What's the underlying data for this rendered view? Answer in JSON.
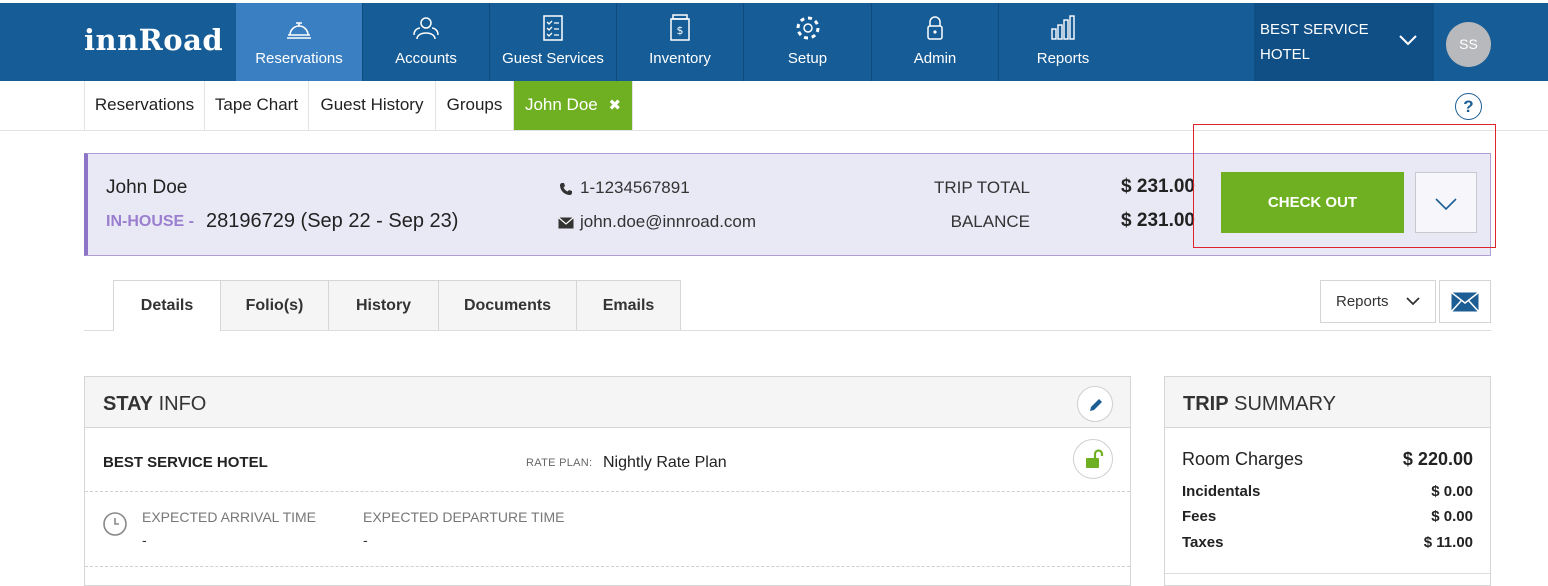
{
  "brand": {
    "logo": "innRoad"
  },
  "topnav": {
    "items": [
      {
        "label": "Reservations",
        "icon": "bell-icon",
        "active": true
      },
      {
        "label": "Accounts",
        "icon": "users-icon"
      },
      {
        "label": "Guest Services",
        "icon": "checklist-icon"
      },
      {
        "label": "Inventory",
        "icon": "inventory-icon"
      },
      {
        "label": "Setup",
        "icon": "gear-icon"
      },
      {
        "label": "Admin",
        "icon": "lock-icon"
      },
      {
        "label": "Reports",
        "icon": "bar-chart-icon"
      }
    ],
    "hotel_line1": "BEST SERVICE",
    "hotel_line2": "HOTEL",
    "avatar": "SS"
  },
  "subnav": {
    "tabs": [
      "Reservations",
      "Tape Chart",
      "Guest History",
      "Groups"
    ],
    "open_tab": "John Doe",
    "help": "?"
  },
  "reservation": {
    "guest_name": "John Doe",
    "status": "IN-HOUSE -",
    "number": "28196729 (Sep 22 - Sep 23)",
    "phone": "1-1234567891",
    "email": "john.doe@innroad.com",
    "trip_total_label": "TRIP TOTAL",
    "trip_total": "$ 231.00",
    "balance_label": "BALANCE",
    "balance": "$ 231.00",
    "checkout_label": "CHECK OUT"
  },
  "detail_tabs": [
    "Details",
    "Folio(s)",
    "History",
    "Documents",
    "Emails"
  ],
  "reports_label": "Reports",
  "stay_info": {
    "title_bold": "STAY",
    "title_rest": " INFO",
    "hotel": "BEST SERVICE HOTEL",
    "rate_plan_label": "RATE PLAN:",
    "rate_plan": "Nightly Rate Plan",
    "arrival_label": "EXPECTED ARRIVAL TIME",
    "arrival_value": "-",
    "departure_label": "EXPECTED DEPARTURE TIME",
    "departure_value": "-"
  },
  "trip_summary": {
    "title_bold": "TRIP",
    "title_rest": " SUMMARY",
    "rows": [
      {
        "label": "Room Charges",
        "value": "$ 220.00"
      },
      {
        "label": "Incidentals",
        "value": "$ 0.00"
      },
      {
        "label": "Fees",
        "value": "$ 0.00"
      },
      {
        "label": "Taxes",
        "value": "$ 11.00"
      }
    ]
  },
  "colors": {
    "nav": "#165c96",
    "nav_active": "#3a7fc1",
    "green": "#6fb022",
    "purple": "#8e74c6",
    "highlight": "#e0242e"
  }
}
